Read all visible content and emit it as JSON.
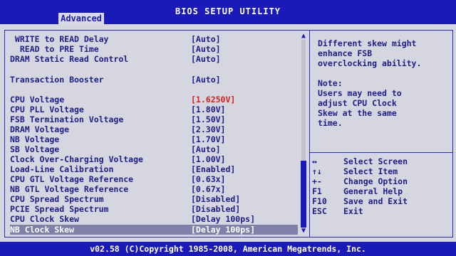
{
  "title": "BIOS SETUP UTILITY",
  "tab": "Advanced",
  "settings": [
    {
      "label": " WRITE to READ Delay",
      "value": "[Auto]"
    },
    {
      "label": "  READ to PRE Time",
      "value": "[Auto]"
    },
    {
      "label": "DRAM Static Read Control",
      "value": "[Auto]"
    },
    {
      "label": "Transaction Booster",
      "value": "[Auto]"
    },
    {
      "label": "CPU Voltage",
      "value": "[1.6250V]"
    },
    {
      "label": "CPU PLL Voltage",
      "value": "[1.80V]"
    },
    {
      "label": "FSB Termination Voltage",
      "value": "[1.50V]"
    },
    {
      "label": "DRAM Voltage",
      "value": "[2.30V]"
    },
    {
      "label": "NB Voltage",
      "value": "[1.70V]"
    },
    {
      "label": "SB Voltage",
      "value": "[Auto]"
    },
    {
      "label": "Clock Over-Charging Voltage",
      "value": "[1.00V]"
    },
    {
      "label": "Load-Line Calibration",
      "value": "[Enabled]"
    },
    {
      "label": "CPU GTL Voltage Reference",
      "value": "[0.63x]"
    },
    {
      "label": "NB GTL Voltage Reference",
      "value": "[0.67x]"
    },
    {
      "label": "CPU Spread Spectrum",
      "value": "[Disabled]"
    },
    {
      "label": "PCIE Spread Spectrum",
      "value": "[Disabled]"
    },
    {
      "label": "CPU Clock Skew",
      "value": "[Delay 100ps]"
    },
    {
      "label": "NB Clock Skew",
      "value": "[Delay 100ps]"
    }
  ],
  "help": {
    "lines": [
      "Different skew might",
      "enhance FSB",
      "overclocking ability.",
      "",
      "Note:",
      "Users may need to",
      "adjust CPU Clock",
      "Skew at the same",
      "time."
    ]
  },
  "keys": [
    {
      "key": "↔",
      "desc": "Select Screen"
    },
    {
      "key": "↑↓",
      "desc": "Select Item"
    },
    {
      "key": "+-",
      "desc": "Change Option"
    },
    {
      "key": "F1",
      "desc": "General Help"
    },
    {
      "key": "F10",
      "desc": "Save and Exit"
    },
    {
      "key": "ESC",
      "desc": "Exit"
    }
  ],
  "footer": "v02.58 (C)Copyright 1985-2008, American Megatrends, Inc.",
  "colors": {
    "title_bar": "#1a1ab8",
    "panel": "#d6d6e0",
    "text": "#1d1d8e",
    "highlight_value": "#d8201e",
    "selected_row": "#8080a8"
  },
  "selected_item": "NB Clock Skew",
  "highlighted_value_item": "CPU Voltage"
}
